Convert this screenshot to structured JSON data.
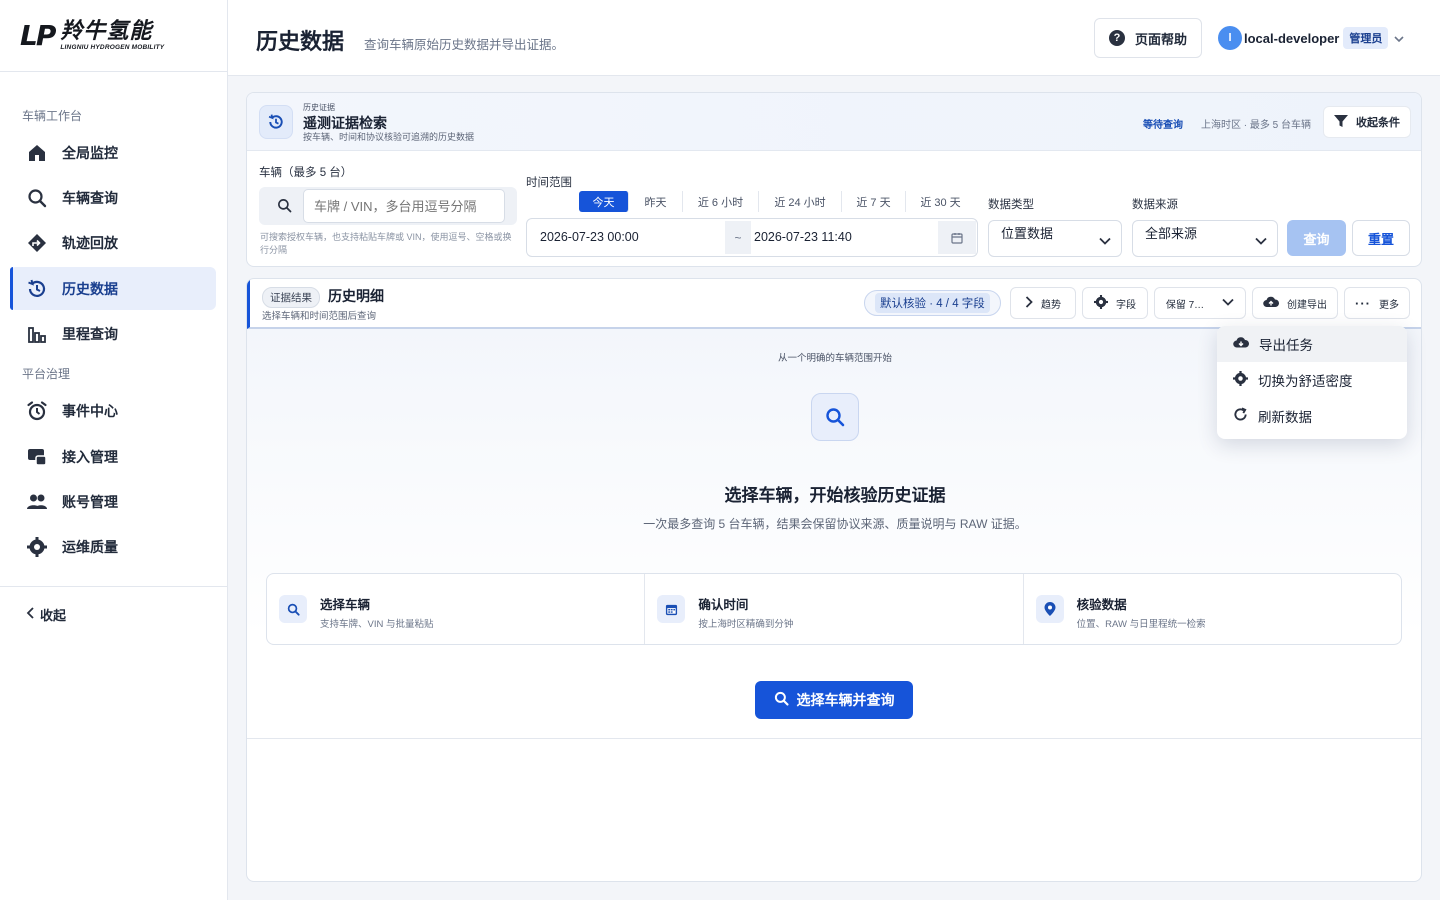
{
  "brand": {
    "mark": "LP",
    "name_cn": "羚牛氢能",
    "name_en": "LINGNIU HYDROGEN MOBILITY"
  },
  "sidebar": {
    "group_workspace": "车辆工作台",
    "group_platform": "平台治理",
    "items": [
      {
        "label": "全局监控",
        "icon": "home-icon"
      },
      {
        "label": "车辆查询",
        "icon": "search-icon"
      },
      {
        "label": "轨迹回放",
        "icon": "route-icon"
      },
      {
        "label": "历史数据",
        "icon": "history-icon",
        "active": true
      },
      {
        "label": "里程查询",
        "icon": "bar-chart-icon"
      },
      {
        "label": "事件中心",
        "icon": "alarm-icon"
      },
      {
        "label": "接入管理",
        "icon": "device-icon"
      },
      {
        "label": "账号管理",
        "icon": "users-icon"
      },
      {
        "label": "运维质量",
        "icon": "gear-icon"
      }
    ],
    "collapse": "收起"
  },
  "header": {
    "title": "历史数据",
    "subtitle": "查询车辆原始历史数据并导出证据。",
    "help": "页面帮助",
    "user": {
      "initial": "l",
      "name": "local-developer",
      "role": "管理员"
    }
  },
  "search": {
    "kicker": "历史证据",
    "title": "遥测证据检索",
    "desc": "按车辆、时间和协议核验可追溯的历史数据",
    "status": "等待查询",
    "tz_note": "上海时区 · 最多 5 台车辆",
    "collapse": "收起条件",
    "vehicle_label": "车辆（最多 5 台）",
    "vehicle_placeholder": "车牌 / VIN，多台用逗号分隔",
    "vehicle_hint": "可搜索授权车辆，也支持粘贴车牌或 VIN，使用逗号、空格或换行分隔",
    "time_label": "时间范围",
    "presets": [
      "今天",
      "昨天",
      "近 6 小时",
      "近 24 小时",
      "近 7 天",
      "近 30 天"
    ],
    "start": "2026-07-23 00:00",
    "end": "2026-07-23 11:40",
    "separator": "~",
    "datatype_label": "数据类型",
    "datatype_value": "位置数据",
    "source_label": "数据来源",
    "source_value": "全部来源",
    "query": "查询",
    "reset": "重置"
  },
  "result": {
    "tag": "证据结果",
    "title": "历史明细",
    "sub": "选择车辆和时间范围后查询",
    "check_badge": "默认核验 · 4 / 4 字段",
    "trend": "趋势",
    "fields": "字段",
    "retain": "保留 7…",
    "export": "创建导出",
    "more": "更多",
    "kicker": "从一个明确的车辆范围开始",
    "empty_title": "选择车辆，开始核验历史证据",
    "empty_desc": "一次最多查询 5 台车辆，结果会保留协议来源、质量说明与 RAW 证据。",
    "steps": [
      {
        "title": "选择车辆",
        "desc": "支持车牌、VIN 与批量粘贴",
        "icon": "search-icon"
      },
      {
        "title": "确认时间",
        "desc": "按上海时区精确到分钟",
        "icon": "calendar-icon"
      },
      {
        "title": "核验数据",
        "desc": "位置、RAW 与日里程统一检索",
        "icon": "location-pin-icon"
      }
    ],
    "cta": "选择车辆并查询"
  },
  "menu": {
    "items": [
      {
        "label": "导出任务",
        "icon": "cloud-download-icon"
      },
      {
        "label": "切换为舒适密度",
        "icon": "gear-icon"
      },
      {
        "label": "刷新数据",
        "icon": "refresh-icon"
      }
    ]
  },
  "colors": {
    "accent": "#1654d9",
    "active_bg": "#e8eefb",
    "disabled_btn": "#a6c3f2"
  }
}
